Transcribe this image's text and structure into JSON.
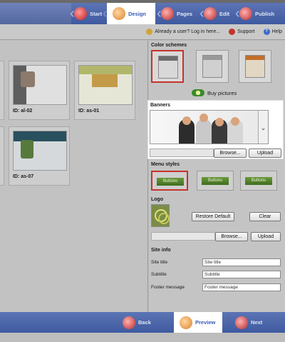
{
  "top_nav": {
    "steps": [
      {
        "label": "Start",
        "icon": "start-icon"
      },
      {
        "label": "Design",
        "icon": "design-icon",
        "active": true
      },
      {
        "label": "Pages",
        "icon": "pages-icon"
      },
      {
        "label": "Edit",
        "icon": "edit-icon"
      },
      {
        "label": "Publish",
        "icon": "publish-icon"
      }
    ]
  },
  "user_bar": {
    "login_text": "Already a user? Log in here...",
    "support_label": "Support",
    "help_label": "Help"
  },
  "templates": [
    {
      "id_label": "ID: al-02"
    },
    {
      "id_label": "ID: as-01"
    },
    {
      "id_label": "ID: as-07"
    }
  ],
  "color_schemes": {
    "title": "Color schemes",
    "selected_index": 0,
    "buy_label": "Buy pictures"
  },
  "banners": {
    "title": "Banners",
    "browse_label": "Browse...",
    "upload_label": "Upload"
  },
  "menu_styles": {
    "title": "Menu styles",
    "items": [
      {
        "label": "Buttons"
      },
      {
        "label": "Buttons"
      },
      {
        "label": "Buttons"
      }
    ],
    "selected_index": 0
  },
  "logo": {
    "title": "Logo",
    "restore_label": "Restore Default",
    "clear_label": "Clear",
    "browse_label": "Browse...",
    "upload_label": "Upload"
  },
  "site_info": {
    "title": "Site info",
    "fields": [
      {
        "label": "Site title",
        "value": "Site title"
      },
      {
        "label": "Subtitle",
        "value": "Subtitle"
      },
      {
        "label": "Footer message",
        "value": "Footer message"
      }
    ]
  },
  "bottom_nav": {
    "back_label": "Back",
    "preview_label": "Preview",
    "next_label": "Next"
  },
  "colors": {
    "nav_blue": "#4a63a8",
    "selection_red": "#c8322b",
    "active_tab_text": "#3b5bb5"
  }
}
